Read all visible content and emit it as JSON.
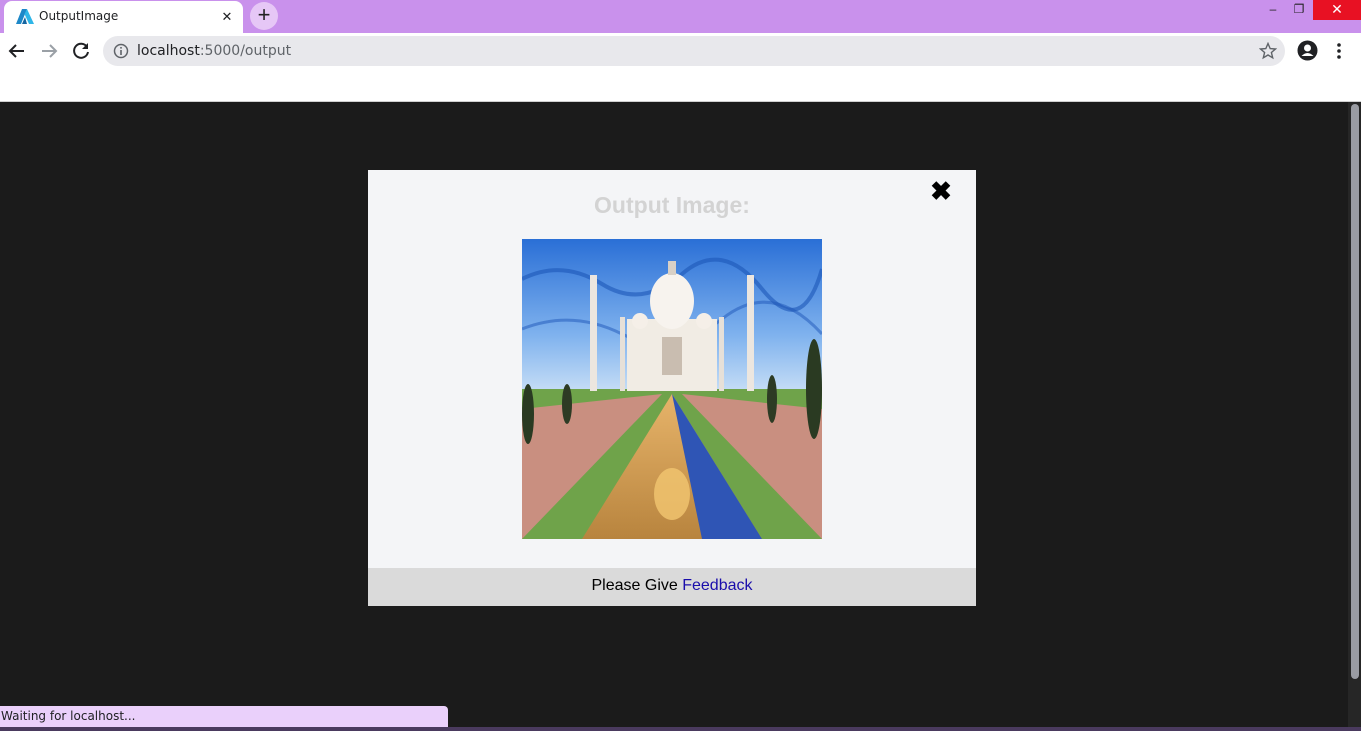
{
  "tab": {
    "title": "OutputImage",
    "close": "✕"
  },
  "new_tab": "+",
  "window_controls": {
    "minimize": "‒",
    "restore": "❐",
    "close": "✕"
  },
  "address": {
    "host": "localhost",
    "path": ":5000/output"
  },
  "modal": {
    "title": "Output Image:",
    "close": "✖",
    "image_description_icon": "taj-mahal-painting"
  },
  "feedback": {
    "prefix": "Please Give ",
    "link": "Feedback"
  },
  "status": "Waiting for localhost...",
  "colors": {
    "tabbar": "#c991ec",
    "page_bg": "#1b1b1b",
    "modal_bg": "#f4f5f7",
    "feedback_bg": "#dadada",
    "link": "#1a0dab"
  }
}
